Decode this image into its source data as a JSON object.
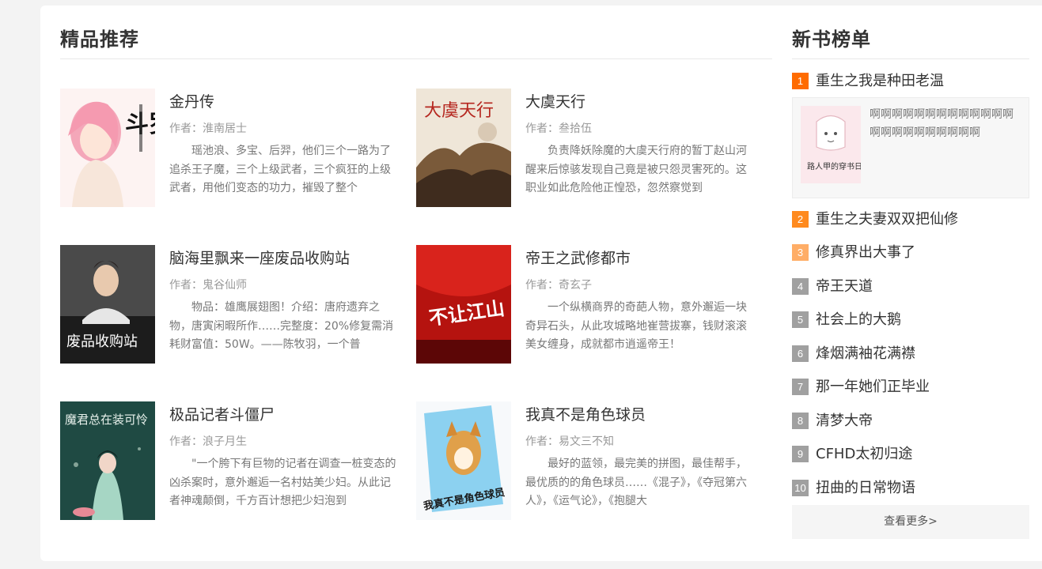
{
  "recommend": {
    "title": "精品推荐",
    "books": [
      {
        "title": "金丹传",
        "author": "作者：淮南居士",
        "desc": "瑶池浪、多宝、后羿，他们三个一路为了追杀王子魔，三个上级武者，三个疯狂的上级武者，用他们变态的功力，摧毁了整个",
        "cover_text": "斗罗"
      },
      {
        "title": "大虞天行",
        "author": "作者：叁拾伍",
        "desc": "负责降妖除魔的大虞天行府的暂丁赵山河醒来后惊骇发现自己竟是被只怨灵害死的。这职业如此危险他正惶恐，忽然察觉到",
        "cover_text": "大虞天行"
      },
      {
        "title": "脑海里飘来一座废品收购站",
        "author": "作者：鬼谷仙师",
        "desc": "物品：雄鹰展翅图！介绍：唐府遗弃之物，唐寅闲暇所作……完整度：20%修复需消耗财富值：50W。——陈牧羽，一个普",
        "cover_text": "废品收购站"
      },
      {
        "title": "帝王之武修都市",
        "author": "作者：奇玄子",
        "desc": "一个纵横商界的奇葩人物，意外邂逅一块奇异石头，从此攻城略地崔营拔寨，钱财滚滚美女缠身，成就都市逍遥帝王！",
        "cover_text": "不让江山"
      },
      {
        "title": "极品记者斗僵尸",
        "author": "作者：浪子月生",
        "desc": "\"一个胯下有巨物的记者在调查一桩变态的凶杀案时，意外邂逅一名村姑美少妇。从此记者神魂颠倒，千方百计想把少妇泡到",
        "cover_text": "魔君总在装可怜"
      },
      {
        "title": "我真不是角色球员",
        "author": "作者：易文三不知",
        "desc": "最好的蓝领，最完美的拼图，最佳帮手，最优质的的角色球员……《混子》，《夺冠第六人》，《运气论》，《抱腿大",
        "cover_text": "我真不是角色球员"
      }
    ]
  },
  "ranking": {
    "title": "新书榜单",
    "featured_desc": "啊啊啊啊啊啊啊啊啊啊啊啊啊啊啊啊啊啊啊啊啊啊啊",
    "featured_cover_text": "路人甲的穿书日常",
    "items": [
      {
        "num": "1",
        "name": "重生之我是种田老温",
        "color": "#ff6b00"
      },
      {
        "num": "2",
        "name": "重生之夫妻双双把仙修",
        "color": "#ff8a1e"
      },
      {
        "num": "3",
        "name": "修真界出大事了",
        "color": "#ffad66"
      },
      {
        "num": "4",
        "name": "帝王天道",
        "color": "#a0a0a0"
      },
      {
        "num": "5",
        "name": "社会上的大鹅",
        "color": "#a0a0a0"
      },
      {
        "num": "6",
        "name": "烽烟满袖花满襟",
        "color": "#a0a0a0"
      },
      {
        "num": "7",
        "name": "那一年她们正毕业",
        "color": "#a0a0a0"
      },
      {
        "num": "8",
        "name": "清梦大帝",
        "color": "#a0a0a0"
      },
      {
        "num": "9",
        "name": "CFHD太初归途",
        "color": "#a0a0a0"
      },
      {
        "num": "10",
        "name": "扭曲的日常物语",
        "color": "#a0a0a0"
      }
    ],
    "more_label": "查看更多>"
  }
}
